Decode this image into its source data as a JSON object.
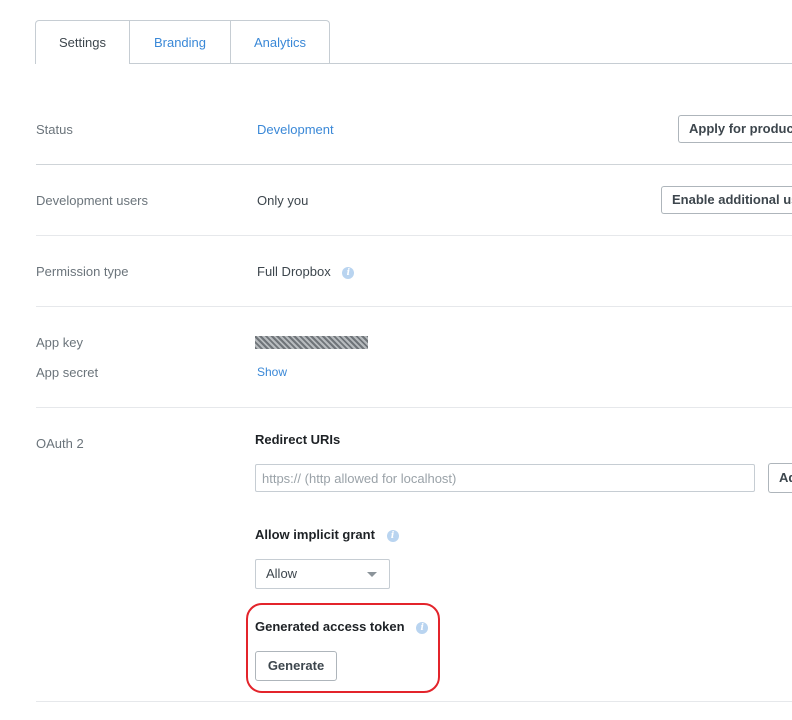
{
  "tabs": {
    "settings": "Settings",
    "branding": "Branding",
    "analytics": "Analytics"
  },
  "status": {
    "label": "Status",
    "value": "Development",
    "button": "Apply for production"
  },
  "dev_users": {
    "label": "Development users",
    "value": "Only you",
    "button": "Enable additional users"
  },
  "permission": {
    "label": "Permission type",
    "value": "Full Dropbox",
    "info_icon": "i"
  },
  "keys": {
    "app_key_label": "App key",
    "app_secret_label": "App secret",
    "show_link": "Show"
  },
  "oauth": {
    "label": "OAuth 2",
    "redirect_heading": "Redirect URIs",
    "redirect_placeholder": "https:// (http allowed for localhost)",
    "add_button": "Add",
    "implicit_heading": "Allow implicit grant",
    "implicit_value": "Allow",
    "token_heading": "Generated access token",
    "generate_button": "Generate"
  },
  "colors": {
    "link": "#3a88d7",
    "highlight": "#e3242b"
  }
}
